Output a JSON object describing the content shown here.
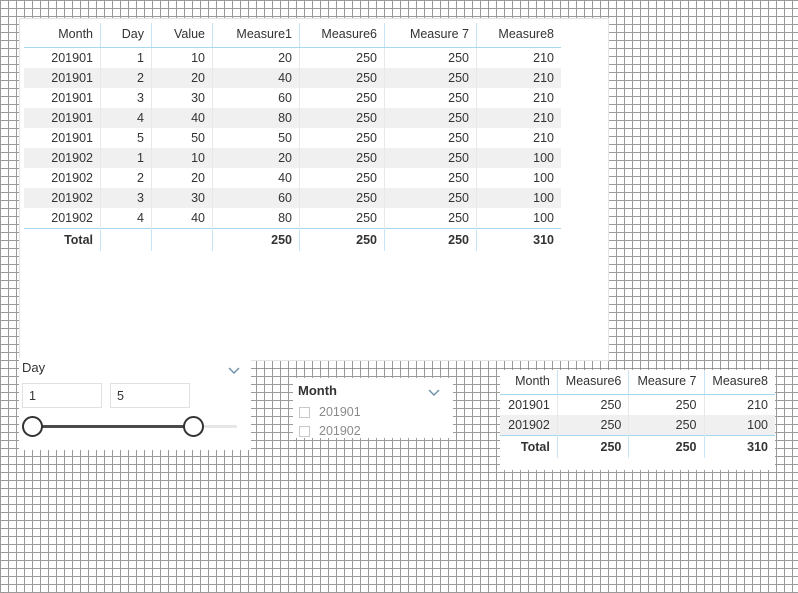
{
  "canvas": {
    "background_color": "#ffffff",
    "grid_dot_color": "#8c8c8c"
  },
  "table_detail": {
    "name": "detail-table",
    "columns": [
      "Month",
      "Day",
      "Value",
      "Measure1",
      "Measure6",
      "Measure 7",
      "Measure8"
    ],
    "rows": [
      [
        "201901",
        "1",
        "10",
        "20",
        "250",
        "250",
        "210"
      ],
      [
        "201901",
        "2",
        "20",
        "40",
        "250",
        "250",
        "210"
      ],
      [
        "201901",
        "3",
        "30",
        "60",
        "250",
        "250",
        "210"
      ],
      [
        "201901",
        "4",
        "40",
        "80",
        "250",
        "250",
        "210"
      ],
      [
        "201901",
        "5",
        "50",
        "50",
        "250",
        "250",
        "210"
      ],
      [
        "201902",
        "1",
        "10",
        "20",
        "250",
        "250",
        "100"
      ],
      [
        "201902",
        "2",
        "20",
        "40",
        "250",
        "250",
        "100"
      ],
      [
        "201902",
        "3",
        "30",
        "60",
        "250",
        "250",
        "100"
      ],
      [
        "201902",
        "4",
        "40",
        "80",
        "250",
        "250",
        "100"
      ]
    ],
    "total_row": [
      "Total",
      "",
      "",
      "250",
      "250",
      "250",
      "310"
    ]
  },
  "table_summary": {
    "name": "summary-table",
    "columns": [
      "Month",
      "Measure6",
      "Measure 7",
      "Measure8"
    ],
    "rows": [
      [
        "201901",
        "250",
        "250",
        "210"
      ],
      [
        "201902",
        "250",
        "250",
        "100"
      ]
    ],
    "total_row": [
      "Total",
      "250",
      "250",
      "310"
    ]
  },
  "day_slicer": {
    "title": "Day",
    "min_value": "1",
    "max_value": "5",
    "min_placeholder": "1",
    "max_placeholder": "5",
    "chevron_icon": "chevron-down-icon",
    "slider": {
      "left_percent": 0,
      "right_percent": 72
    }
  },
  "month_slicer": {
    "title": "Month",
    "chevron_icon": "chevron-down-icon",
    "items": [
      {
        "label": "201901",
        "checked": false
      },
      {
        "label": "201902",
        "checked": false
      }
    ]
  }
}
